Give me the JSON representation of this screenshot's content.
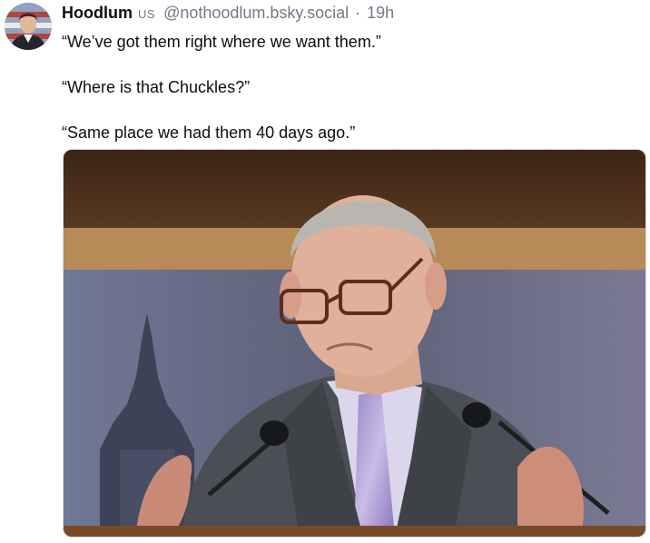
{
  "post": {
    "author": {
      "display_name": "Hoodlum",
      "flag": "US",
      "handle": "@nothoodlum.bsky.social",
      "avatar_icon": "profile-avatar"
    },
    "separator": "·",
    "timestamp": "19h",
    "lines": [
      "“We’ve got them right where we want them.”",
      "“Where is that Chuckles?”",
      "“Same place we had them 40 days ago.”"
    ],
    "image_icon": "photo-man-at-podium"
  },
  "colors": {
    "text": "#0b0f14",
    "muted": "#6f7a86",
    "background": "#ffffff"
  }
}
